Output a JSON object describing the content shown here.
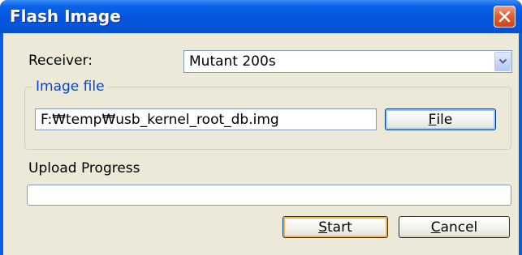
{
  "window": {
    "title": "Flash Image",
    "close_icon": "close-x-icon"
  },
  "receiver": {
    "label": "Receiver:",
    "selected": "Mutant 200s",
    "dropdown_icon": "chevron-down-icon"
  },
  "image_file": {
    "legend": "Image file",
    "path": "F:₩temp₩usb_kernel_root_db.img",
    "file_button": {
      "mnemonic": "F",
      "rest": "ile"
    }
  },
  "upload": {
    "label": "Upload Progress",
    "progress": 0
  },
  "actions": {
    "start": {
      "mnemonic": "S",
      "rest": "tart"
    },
    "cancel": {
      "mnemonic": "C",
      "rest": "ancel"
    }
  },
  "colors": {
    "title_bar": "#0a5de0",
    "dialog_face": "#ece9d8",
    "group_legend": "#0046d5",
    "close_button": "#e25e35",
    "default_button_highlight": "#f8b34e"
  }
}
